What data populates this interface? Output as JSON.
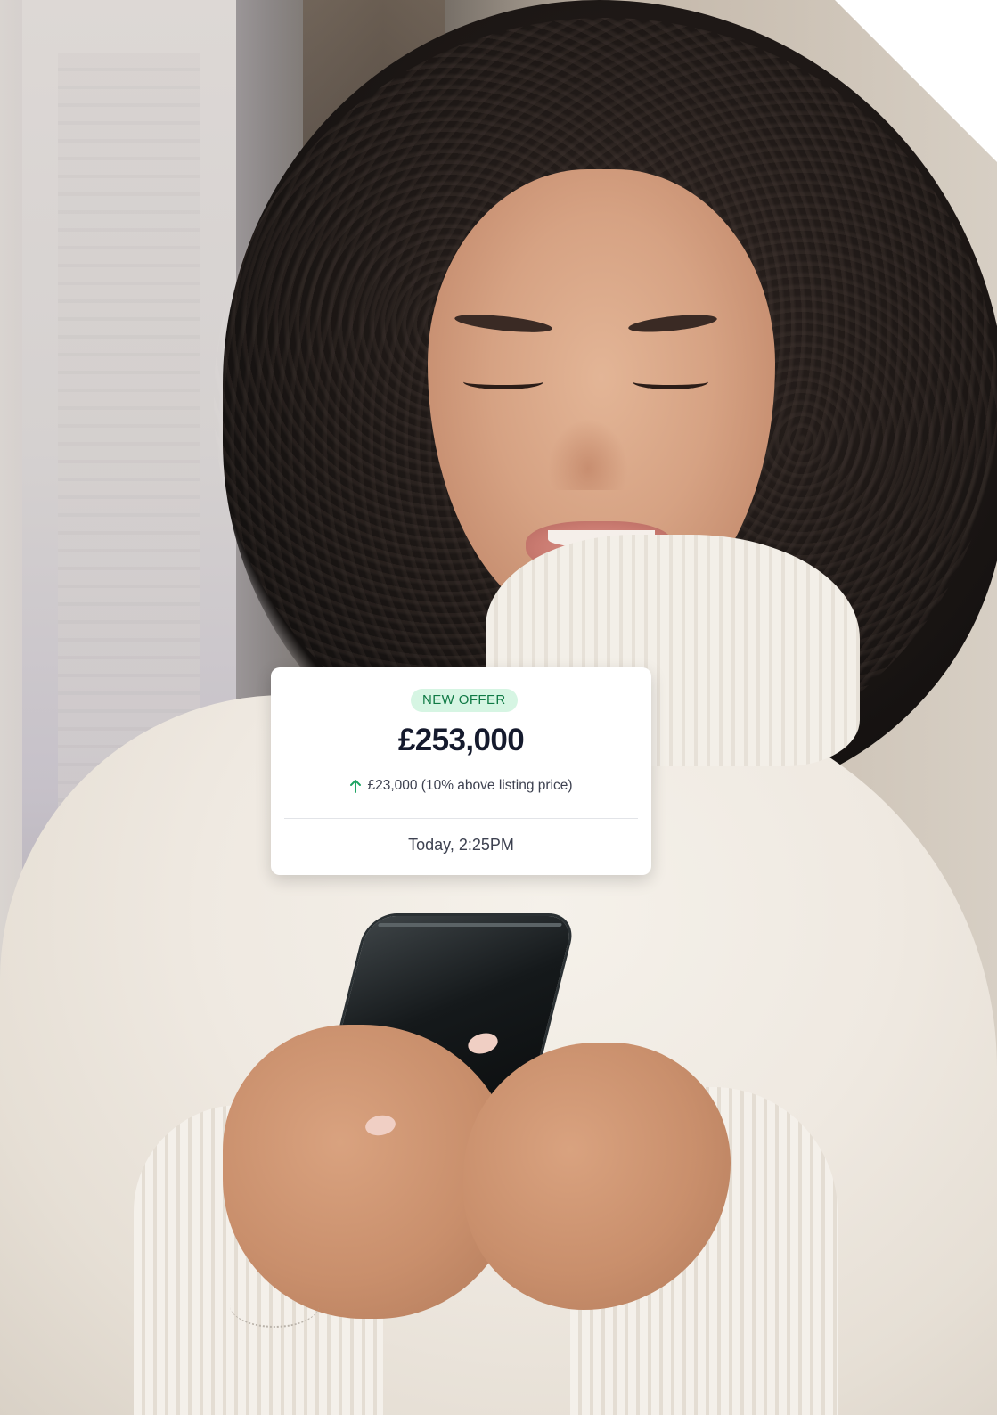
{
  "offer_card": {
    "badge": "NEW OFFER",
    "amount": "£253,000",
    "delta_text": "£23,000 (10% above listing price)",
    "delta_icon": "arrow-up-icon",
    "timestamp": "Today, 2:25PM"
  },
  "colors": {
    "badge_bg": "#d6f5e3",
    "badge_text": "#107a45",
    "amount_text": "#151a2d",
    "arrow": "#1fa463"
  }
}
